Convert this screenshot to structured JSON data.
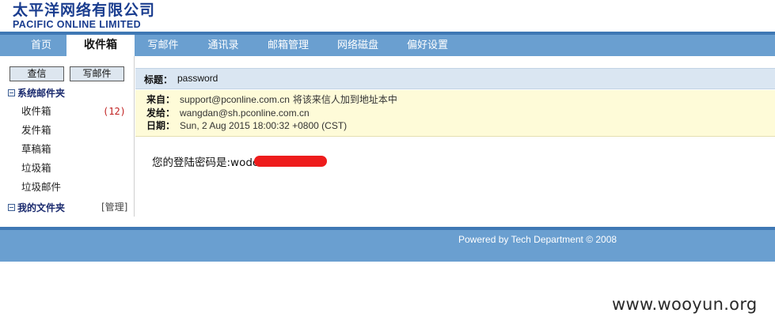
{
  "logo": {
    "cn": "太平洋网络有限公司",
    "en": "PACIFIC ONLINE LIMITED"
  },
  "nav": [
    {
      "label": "首页"
    },
    {
      "label": "收件箱"
    },
    {
      "label": "写邮件"
    },
    {
      "label": "通讯录"
    },
    {
      "label": "邮箱管理"
    },
    {
      "label": "网络磁盘"
    },
    {
      "label": "偏好设置"
    }
  ],
  "sidebar": {
    "check_button": "查信",
    "compose_button": "写邮件",
    "system_folders_title": "系统邮件夹",
    "folders": [
      {
        "label": "收件箱",
        "count": "(12)"
      },
      {
        "label": "发件箱"
      },
      {
        "label": "草稿箱"
      },
      {
        "label": "垃圾箱"
      },
      {
        "label": "垃圾邮件"
      }
    ],
    "my_folders_title": "我的文件夹",
    "manage_link": "[管理]"
  },
  "mail": {
    "subject_label": "标题：",
    "subject": "password",
    "from_label": "来自：",
    "from": "support@pconline.com.cn",
    "add_contact_link": "将该来信人加到地址本中",
    "to_label": "发给：",
    "to": "wangdan@sh.pconline.com.cn",
    "date_label": "日期：",
    "date": "Sun, 2 Aug 2015 18:00:32 +0800 (CST)",
    "body": "您的登陆密码是:wode"
  },
  "footer": {
    "text": "Powered by Tech Department © 2008"
  },
  "watermark": "www.wooyun.org",
  "colors": {
    "nav_bg": "#6a9fd0",
    "accent_line": "#3f78b4",
    "subject_bg": "#dae6f2",
    "meta_bg": "#fefbd8",
    "redaction": "#ee1c1c"
  }
}
